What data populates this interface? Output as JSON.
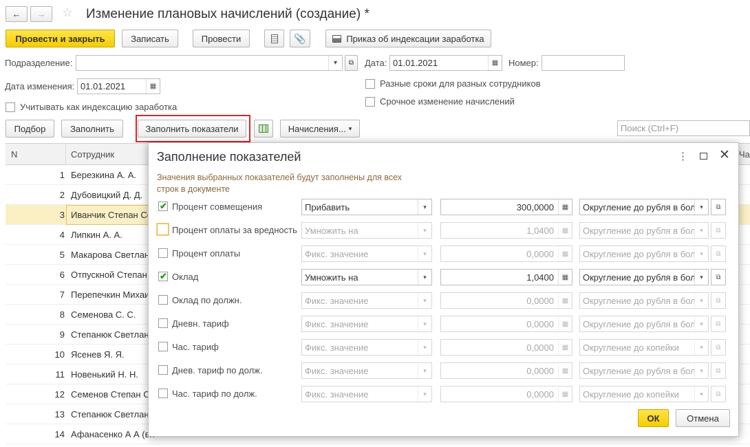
{
  "window": {
    "title": "Изменение плановых начислений (создание) *"
  },
  "toolbar": {
    "post_close": "Провести и закрыть",
    "save": "Записать",
    "post": "Провести",
    "order": "Приказ об индексации заработка"
  },
  "form": {
    "division_label": "Подразделение:",
    "division_value": "",
    "date_label": "Дата:",
    "date_value": "01.01.2021",
    "number_label": "Номер:",
    "number_value": "",
    "change_date_label": "Дата изменения:",
    "change_date_value": "01.01.2021",
    "different_terms": "Разные сроки для разных сотрудников",
    "indexation": "Учитывать как индексацию заработка",
    "urgent": "Срочное изменение начислений"
  },
  "table_toolbar": {
    "pick": "Подбор",
    "fill": "Заполнить",
    "fill_indicators": "Заполнить показатели",
    "accruals": "Начисления...",
    "search_placeholder": "Поиск (Ctrl+F)"
  },
  "grid": {
    "col_n": "N",
    "col_employee": "Сотрудник",
    "col_partial": "Час",
    "rows": [
      {
        "n": "1",
        "employee": "Березкина А. А."
      },
      {
        "n": "2",
        "employee": "Дубовицкий Д. Д."
      },
      {
        "n": "3",
        "employee": "Иванчик Степан Се"
      },
      {
        "n": "4",
        "employee": "Липкин А. А."
      },
      {
        "n": "5",
        "employee": "Макарова Светлан"
      },
      {
        "n": "6",
        "employee": "Отпускной Степан"
      },
      {
        "n": "7",
        "employee": "Перепечкин Михаи"
      },
      {
        "n": "8",
        "employee": "Семенова С. С."
      },
      {
        "n": "9",
        "employee": "Степанюк Светлан"
      },
      {
        "n": "10",
        "employee": "Ясенев Я. Я."
      },
      {
        "n": "11",
        "employee": "Новенький Н. Н."
      },
      {
        "n": "12",
        "employee": "Семенов Степан С"
      },
      {
        "n": "13",
        "employee": "Степанюк Светлан"
      },
      {
        "n": "14",
        "employee": "Афанасенко А А (вн"
      }
    ]
  },
  "dialog": {
    "title": "Заполнение показателей",
    "hint": "Значения выбранных показателей будут заполнены для всех строк в документе",
    "ok": "ОК",
    "cancel": "Отмена",
    "rows": [
      {
        "name": "Процент совмещения",
        "checked": true,
        "op": "Прибавить",
        "value": "300,0000",
        "round": "Округление до рубля в бол",
        "enabled": true
      },
      {
        "name": "Процент оплаты за вредность",
        "checked": false,
        "op": "Умножить на",
        "value": "1,0400",
        "round": "Округление до рубля в бол",
        "enabled": false
      },
      {
        "name": "Процент оплаты",
        "checked": false,
        "op": "Фикс. значение",
        "value": "0,0000",
        "round": "Округление до рубля в бол",
        "enabled": false
      },
      {
        "name": "Оклад",
        "checked": true,
        "op": "Умножить на",
        "value": "1,0400",
        "round": "Округление до рубля в бол",
        "enabled": true
      },
      {
        "name": "Оклад по должн.",
        "checked": false,
        "op": "Фикс. значение",
        "value": "0,0000",
        "round": "Округление до рубля в бол",
        "enabled": false
      },
      {
        "name": "Дневн. тариф",
        "checked": false,
        "op": "Фикс. значение",
        "value": "0,0000",
        "round": "Округление до рубля в бол",
        "enabled": false
      },
      {
        "name": "Час. тариф",
        "checked": false,
        "op": "Фикс. значение",
        "value": "0,0000",
        "round": "Округление до копейки",
        "enabled": false
      },
      {
        "name": "Днев. тариф по долж.",
        "checked": false,
        "op": "Фикс. значение",
        "value": "0,0000",
        "round": "Округление до рубля в бол",
        "enabled": false
      },
      {
        "name": "Час. тариф по долж.",
        "checked": false,
        "op": "Фикс. значение",
        "value": "0,0000",
        "round": "Округление до копейки",
        "enabled": false
      }
    ]
  },
  "colors": {
    "accent_yellow": "#f5cd00",
    "highlight_row": "#fbf0c5",
    "red_frame": "#d9262d",
    "check_green": "#2f9a1c"
  }
}
